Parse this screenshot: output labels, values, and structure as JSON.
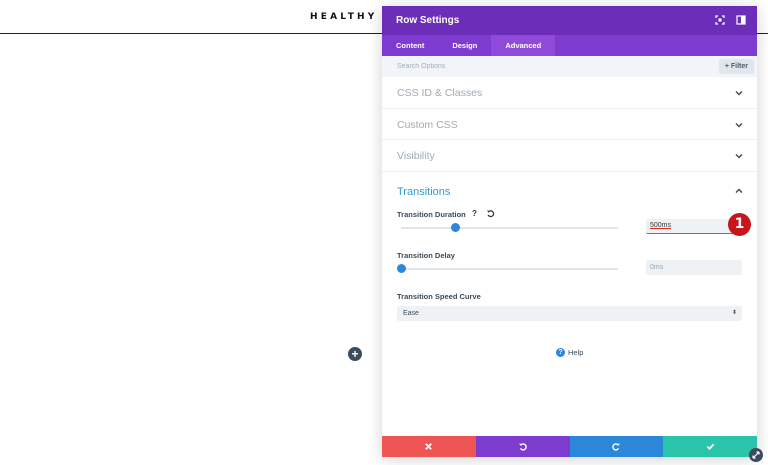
{
  "page": {
    "title": "HEALTHY FO",
    "add_icon": "plus-icon",
    "add_glyph": "+"
  },
  "panel": {
    "title": "Row Settings",
    "header_icons": [
      "expand-icon",
      "dock-icon"
    ],
    "tabs": [
      {
        "label": "Content",
        "active": false
      },
      {
        "label": "Design",
        "active": false
      },
      {
        "label": "Advanced",
        "active": true
      }
    ],
    "search": {
      "placeholder": "Search Options",
      "filter_label": "+ Filter"
    },
    "sections": [
      {
        "label": "CSS ID & Classes",
        "expanded": false
      },
      {
        "label": "Custom CSS",
        "expanded": false
      },
      {
        "label": "Visibility",
        "expanded": false
      }
    ],
    "transitions": {
      "label": "Transitions",
      "expanded": true,
      "duration": {
        "label": "Transition Duration",
        "help_glyph": "?",
        "value": "500ms",
        "slider_fraction": 0.25,
        "badge": "1"
      },
      "delay": {
        "label": "Transition Delay",
        "value": "0ms",
        "slider_fraction": 0.0
      },
      "curve": {
        "label": "Transition Speed Curve",
        "value": "Ease",
        "arrow": "⬍"
      }
    },
    "help": {
      "label": "Help",
      "glyph": "?"
    },
    "footer": [
      {
        "name": "cancel-button",
        "icon": "close-icon",
        "color": "#ef5555"
      },
      {
        "name": "undo-button",
        "icon": "undo-icon",
        "color": "#7e3bd0"
      },
      {
        "name": "redo-button",
        "icon": "redo-icon",
        "color": "#2b87da"
      },
      {
        "name": "save-button",
        "icon": "check-icon",
        "color": "#29c4a9"
      }
    ]
  },
  "colors": {
    "header": "#6c2eb9",
    "tabs": "#7d3bcf",
    "accent": "#2b87da",
    "section_active": "#2e9ccf",
    "badge": "#c8141b"
  }
}
